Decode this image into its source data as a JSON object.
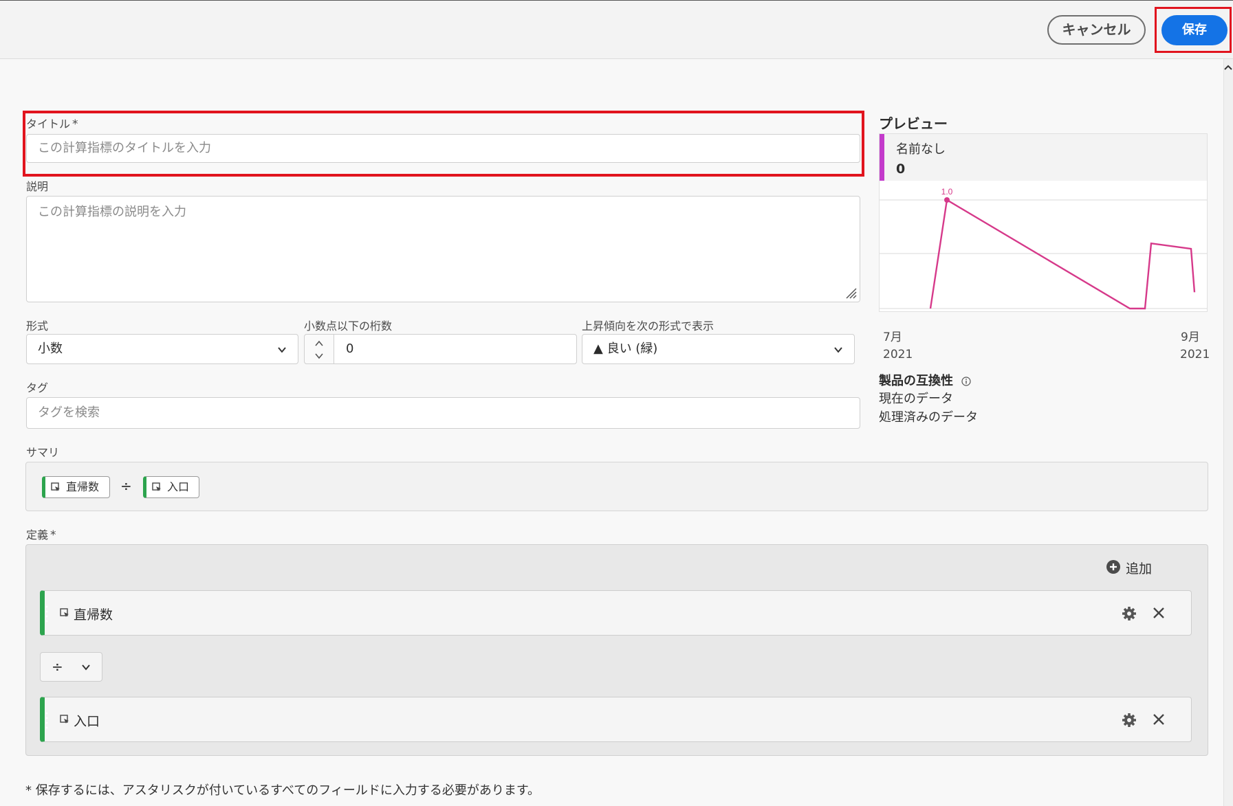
{
  "header": {
    "cancel_label": "キャンセル",
    "save_label": "保存"
  },
  "form": {
    "title_label": "タイトル",
    "title_required": "*",
    "title_placeholder": "この計算指標のタイトルを入力",
    "description_label": "説明",
    "description_placeholder": "この計算指標の説明を入力",
    "format_label": "形式",
    "format_value": "小数",
    "decimals_label": "小数点以下の桁数",
    "decimals_value": "0",
    "trend_label": "上昇傾向を次の形式で表示",
    "trend_value": "▲ 良い (緑)",
    "tags_label": "タグ",
    "tags_placeholder": "タグを検索",
    "summary_label": "サマリ",
    "definition_label": "定義",
    "definition_required": "*",
    "footer_note": "* 保存するには、アスタリスクが付いているすべてのフィールドに入力する必要があります。"
  },
  "summary": {
    "chips": [
      "直帰数",
      "入口"
    ],
    "operator": "÷"
  },
  "definition": {
    "add_label": "追加",
    "metrics": [
      "直帰数",
      "入口"
    ],
    "operator": "÷"
  },
  "preview": {
    "title": "プレビュー",
    "metric_name": "名前なし",
    "metric_value": "0",
    "peak_label": "1.0",
    "x_start_month": "7月",
    "x_start_year": "2021",
    "x_end_month": "9月",
    "x_end_year": "2021",
    "line_color": "#d6398a",
    "accent_color": "#c33acb"
  },
  "compatibility": {
    "title": "製品の互換性",
    "items": [
      "現在のデータ",
      "処理済みのデータ"
    ]
  },
  "colors": {
    "primary": "#1473e6",
    "highlight": "#e1141e",
    "metric_green": "#2da44e"
  },
  "chart_data": {
    "type": "line",
    "ylim": [
      0,
      1.0
    ],
    "x": [
      "7月 2021",
      "9月 2021"
    ],
    "series": [
      {
        "values": [
          0,
          1.0,
          0,
          0,
          0.6,
          0.55,
          0.15
        ]
      }
    ]
  }
}
